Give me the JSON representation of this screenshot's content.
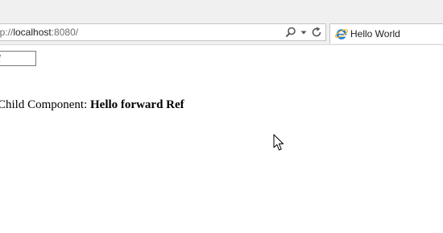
{
  "browser": {
    "address": {
      "prefix": "ttp://",
      "host": "localhost",
      "suffix": ":8080/"
    },
    "tab": {
      "title": "Hello World"
    },
    "icons": {
      "search": "search-icon",
      "dropdown": "chevron-down-icon",
      "refresh": "refresh-icon",
      "tab_favicon": "ie-icon"
    }
  },
  "page": {
    "input_value": "f",
    "child_label": "Child Component: ",
    "child_value": "Hello forward Ref"
  }
}
